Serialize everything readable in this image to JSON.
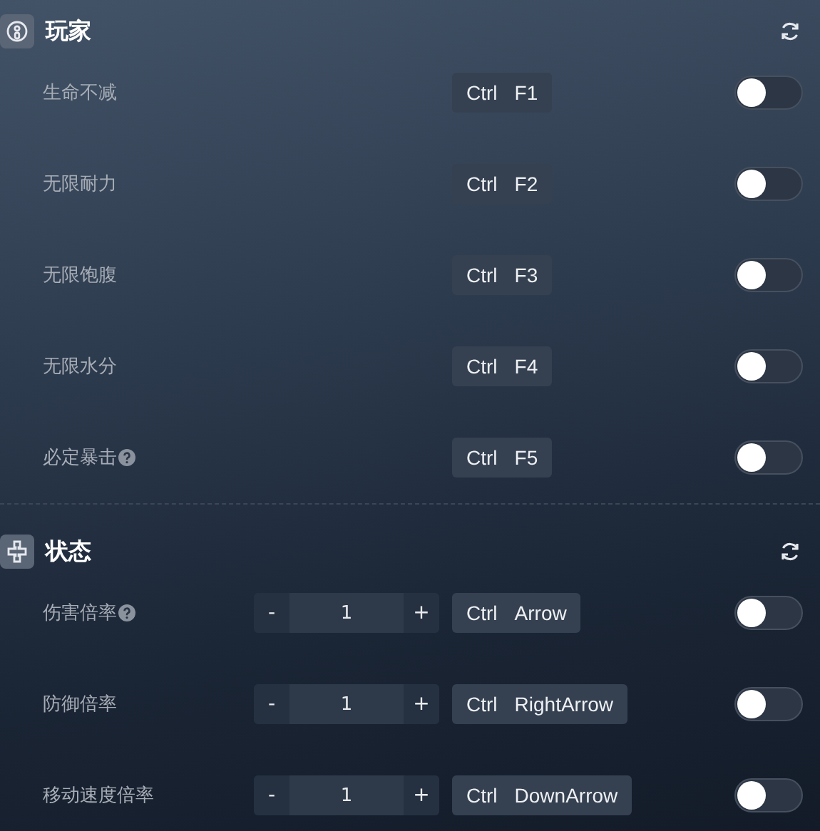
{
  "sections": [
    {
      "title": "玩家",
      "rows": [
        {
          "label": "生命不减",
          "help": false,
          "keys": [
            "Ctrl",
            "F1"
          ],
          "on": false
        },
        {
          "label": "无限耐力",
          "help": false,
          "keys": [
            "Ctrl",
            "F2"
          ],
          "on": false
        },
        {
          "label": "无限饱腹",
          "help": false,
          "keys": [
            "Ctrl",
            "F3"
          ],
          "on": false
        },
        {
          "label": "无限水分",
          "help": false,
          "keys": [
            "Ctrl",
            "F4"
          ],
          "on": false
        },
        {
          "label": "必定暴击",
          "help": true,
          "keys": [
            "Ctrl",
            "F5"
          ],
          "on": false
        }
      ]
    },
    {
      "title": "状态",
      "rows": [
        {
          "label": "伤害倍率",
          "help": true,
          "stepper": {
            "minus": "-",
            "value": "1",
            "plus": "+"
          },
          "keys": [
            "Ctrl",
            "Arrow"
          ],
          "on": false
        },
        {
          "label": "防御倍率",
          "help": false,
          "stepper": {
            "minus": "-",
            "value": "1",
            "plus": "+"
          },
          "keys": [
            "Ctrl",
            "RightArrow"
          ],
          "on": false
        },
        {
          "label": "移动速度倍率",
          "help": false,
          "stepper": {
            "minus": "-",
            "value": "1",
            "plus": "+"
          },
          "keys": [
            "Ctrl",
            "DownArrow"
          ],
          "on": false
        }
      ]
    }
  ]
}
